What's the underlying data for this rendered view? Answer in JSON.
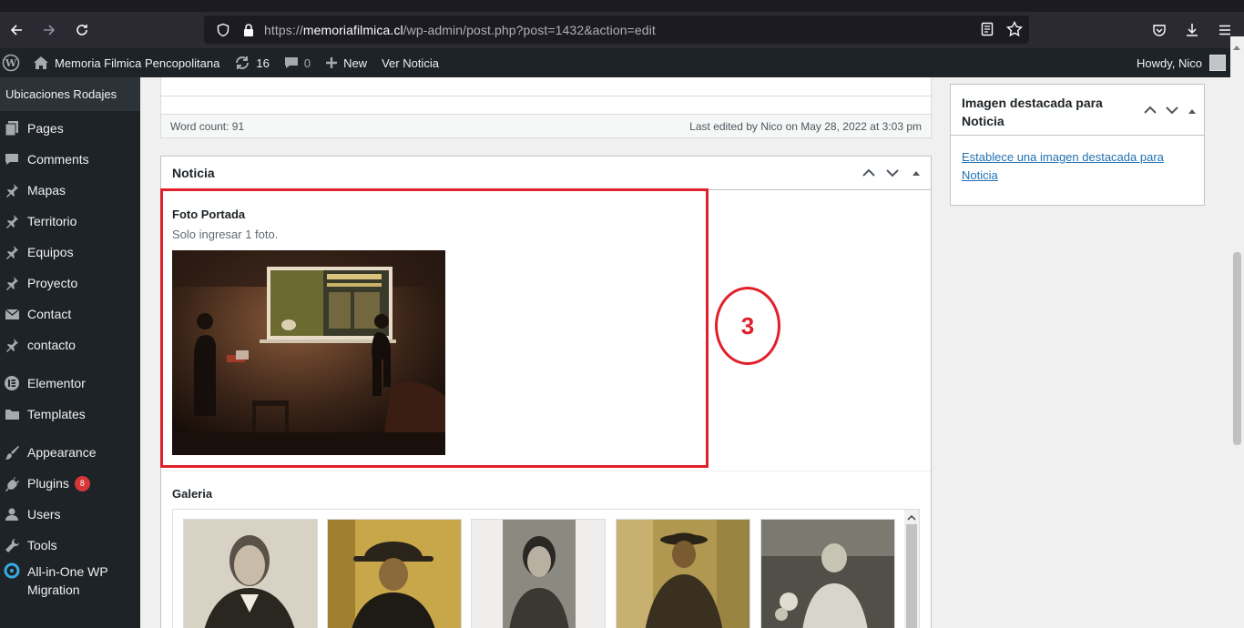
{
  "browser": {
    "url_scheme": "https://",
    "url_host": "memoriafilmica.cl",
    "url_path": "/wp-admin/post.php?post=1432&action=edit"
  },
  "adminbar": {
    "site_name": "Memoria Filmica Pencopolitana",
    "updates_count": "16",
    "comments_count": "0",
    "new_label": "New",
    "view_label": "Ver Noticia",
    "howdy": "Howdy, Nico"
  },
  "sidebar": {
    "top_item": "Ubicaciones Rodajes",
    "items": [
      {
        "label": "Pages",
        "icon": "pages-icon"
      },
      {
        "label": "Comments",
        "icon": "comments-icon"
      },
      {
        "label": "Mapas",
        "icon": "pin-icon"
      },
      {
        "label": "Territorio",
        "icon": "pin-icon"
      },
      {
        "label": "Equipos",
        "icon": "pin-icon"
      },
      {
        "label": "Proyecto",
        "icon": "pin-icon"
      },
      {
        "label": "Contact",
        "icon": "mail-icon"
      },
      {
        "label": "contacto",
        "icon": "pin-icon"
      },
      {
        "label": "Elementor",
        "icon": "elementor-icon"
      },
      {
        "label": "Templates",
        "icon": "folder-icon"
      },
      {
        "label": "Appearance",
        "icon": "brush-icon"
      },
      {
        "label": "Plugins",
        "icon": "plugin-icon",
        "badge": "8"
      },
      {
        "label": "Users",
        "icon": "users-icon"
      },
      {
        "label": "Tools",
        "icon": "wrench-icon"
      },
      {
        "label": "All-in-One WP Migration",
        "icon": "migration-icon"
      }
    ]
  },
  "editor": {
    "word_count": "Word count: 91",
    "last_edited": "Last edited by Nico on May 28, 2022 at 3:03 pm"
  },
  "noticia_box": {
    "title": "Noticia",
    "foto_label": "Foto Portada",
    "foto_desc": "Solo ingresar 1 foto.",
    "galeria_label": "Galeria"
  },
  "annotation": {
    "number": "3",
    "color": "#e0202a"
  },
  "featured_box": {
    "title": "Imagen destacada para Noticia",
    "link": "Establece una imagen destacada para Noticia"
  }
}
